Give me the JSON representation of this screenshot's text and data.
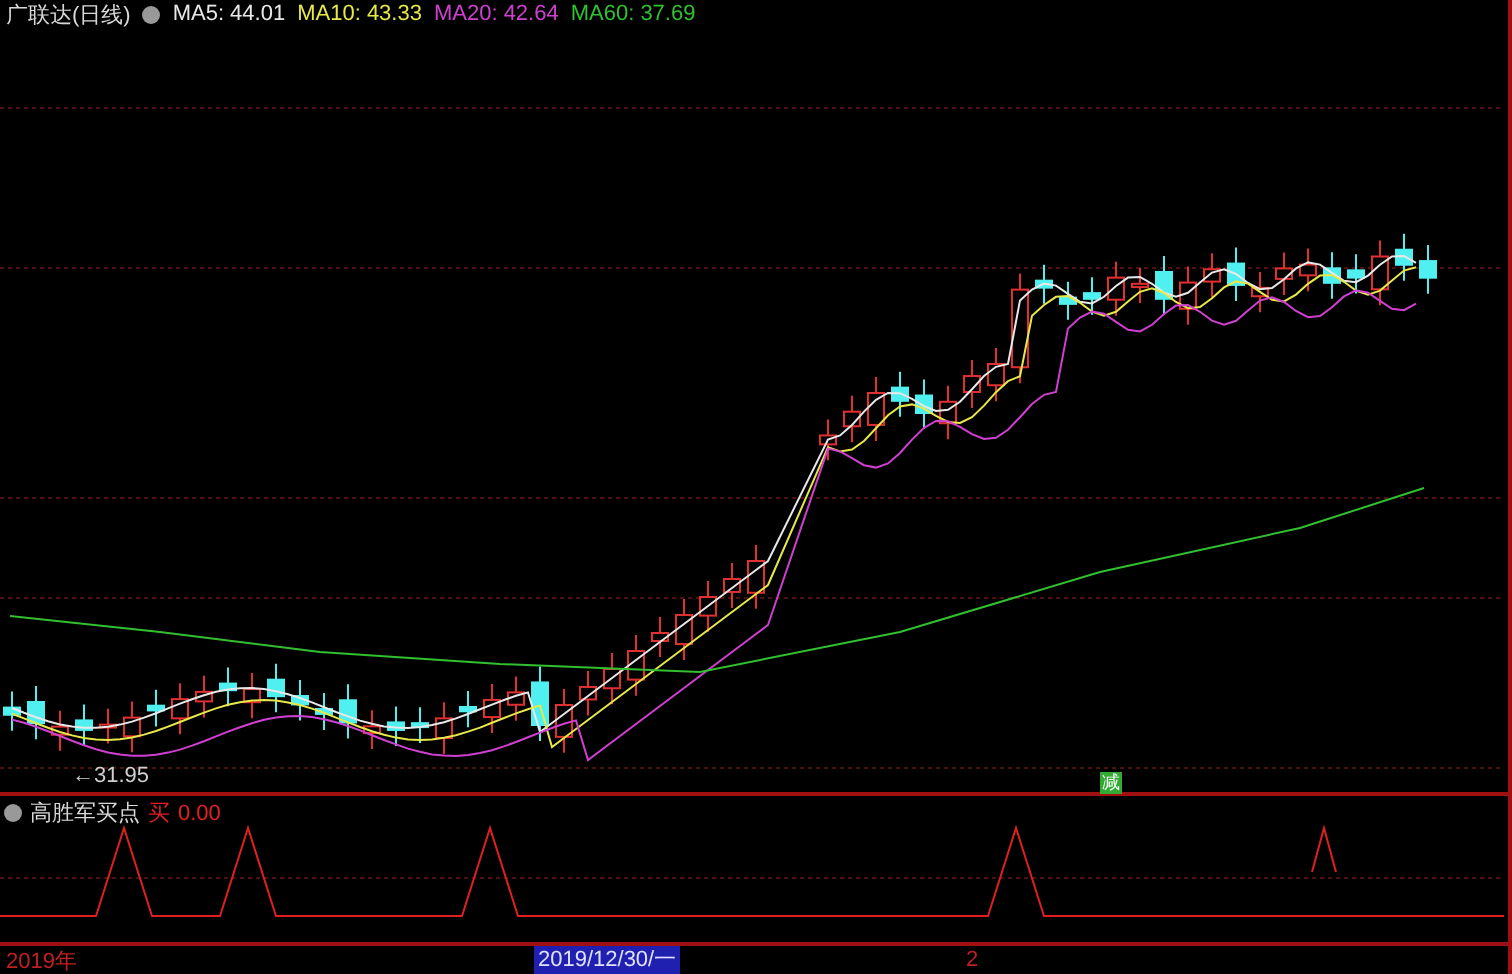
{
  "chart_header": {
    "title": "广联达(日线)",
    "indicators": [
      {
        "label": "MA5: 44.01",
        "color": "#e8e8e8"
      },
      {
        "label": "MA10: 43.33",
        "color": "#e8e84a"
      },
      {
        "label": "MA20: 42.64",
        "color": "#d040d0"
      },
      {
        "label": "MA60: 37.69",
        "color": "#30c030"
      }
    ]
  },
  "price_chart": {
    "low_marker": "←31.95",
    "signal_badge": "减"
  },
  "indicator_panel": {
    "title": "高胜军买点",
    "buy_label": "买",
    "buy_value": "0.00"
  },
  "time_axis": {
    "start_label": "2019年",
    "cursor_date": "2019/12/30/一",
    "tick_label": "2"
  }
}
